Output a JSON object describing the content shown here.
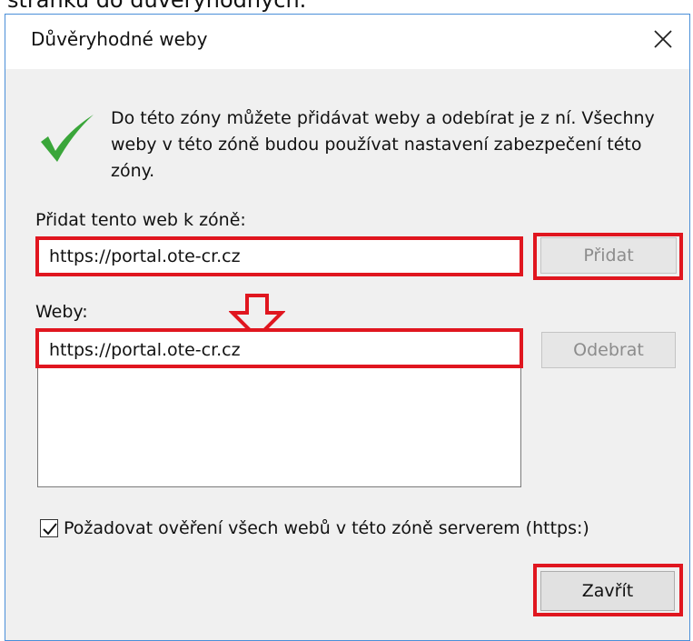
{
  "caption": "stránku do důvěryhodných.",
  "dialog": {
    "title": "Důvěryhodné weby",
    "close_icon": "close-icon",
    "info_icon": "check-icon",
    "description": "Do této zóny můžete přidávat weby a odebírat je z ní. Všechny weby v této zóně budou používat nastavení zabezpečení této zóny.",
    "add_label": "Přidat tento web k zóně:",
    "add_input_value": "https://portal.ote-cr.cz",
    "add_button": "Přidat",
    "sites_label": "Weby:",
    "sites": [
      "https://portal.ote-cr.cz"
    ],
    "remove_button": "Odebrat",
    "require_https_label": "Požadovat ověření všech webů v této zóně serverem (https:)",
    "require_https_checked": true,
    "close_button": "Zavřít",
    "highlight_color": "#e0161f",
    "check_color": "#3aa63a"
  }
}
